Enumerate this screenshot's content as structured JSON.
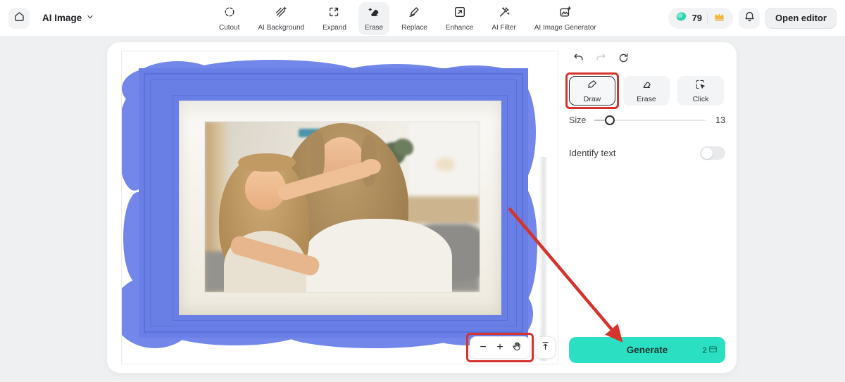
{
  "header": {
    "product_label": "AI Image",
    "tools": [
      {
        "label": "Cutout"
      },
      {
        "label": "AI Background"
      },
      {
        "label": "Expand"
      },
      {
        "label": "Erase",
        "active": true
      },
      {
        "label": "Replace"
      },
      {
        "label": "Enhance"
      },
      {
        "label": "AI Filter"
      },
      {
        "label": "AI Image Generator"
      }
    ],
    "credits": "79",
    "open_editor_label": "Open editor"
  },
  "panel": {
    "modes": [
      {
        "label": "Draw",
        "selected": true,
        "highlighted_with_red_box": true
      },
      {
        "label": "Erase"
      },
      {
        "label": "Click"
      }
    ],
    "size_label": "Size",
    "size_value": "13",
    "identify_text_label": "Identify text",
    "identify_text_on": false,
    "generate_label": "Generate",
    "generate_cost": "2"
  },
  "canvas_controls": {
    "zoom_out_label": "−",
    "zoom_in_label": "+"
  },
  "colors": {
    "accent_red": "#D4342C",
    "mask_blue": "#7387EA",
    "frame_blue": "#6A7FE6",
    "generate_teal": "#2BE0C2",
    "coin_teal": "#2FD3B0",
    "crown_gold": "#F2B73C"
  }
}
